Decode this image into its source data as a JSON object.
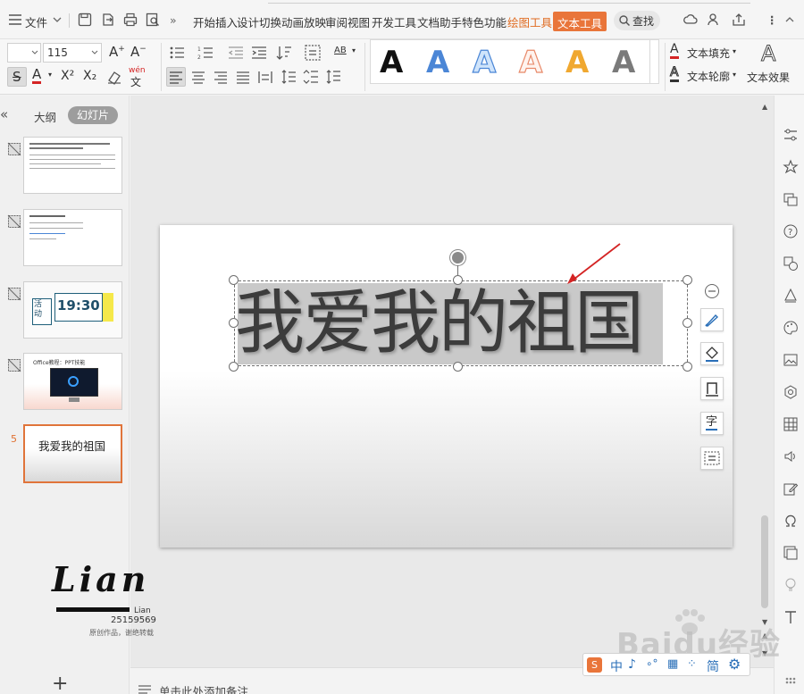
{
  "menubar": {
    "file_label": "文件",
    "tabs": [
      "开始",
      "插入",
      "设计",
      "切换",
      "动画",
      "放映",
      "审阅",
      "视图",
      "开发工具",
      "文档助手",
      "特色功能"
    ],
    "drawing_tools": "绘图工具",
    "text_tools": "文本工具",
    "search_label": "查找"
  },
  "ribbon": {
    "font_size": "115",
    "wordart_letter": "A",
    "text_fill": "文本填充",
    "text_outline": "文本轮廓",
    "text_effect": "文本效果",
    "ab_label": "AB",
    "superscript": "X²",
    "subscript": "X₂",
    "pinyin": "wén"
  },
  "left_panel": {
    "tab_outline": "大纲",
    "tab_slides": "幻灯片",
    "slides": [
      {
        "title": "",
        "number": ""
      },
      {
        "title": "",
        "number": ""
      },
      {
        "title": "19:30",
        "badge": "活动",
        "number": ""
      },
      {
        "title": "Office教程：PPT技能",
        "number": ""
      },
      {
        "title": "我爱我的祖国",
        "number": "5"
      }
    ]
  },
  "slide": {
    "title_text": "我爱我的祖国"
  },
  "notes": {
    "placeholder": "单击此处添加备注"
  },
  "watermark": {
    "logo_text": "Lian",
    "logo_sub": "Lian",
    "id_number": "25159569",
    "copyright": "原创作品，谢绝转载",
    "baidu_text": "Baidu经验"
  },
  "ime": {
    "lang": "中",
    "simplified": "简"
  },
  "colors": {
    "accent": "#e9753a",
    "arrow": "#d42424",
    "wordart_blue": "#4b86d6",
    "wordart_orange": "#f0a830"
  },
  "add_slide": "+"
}
